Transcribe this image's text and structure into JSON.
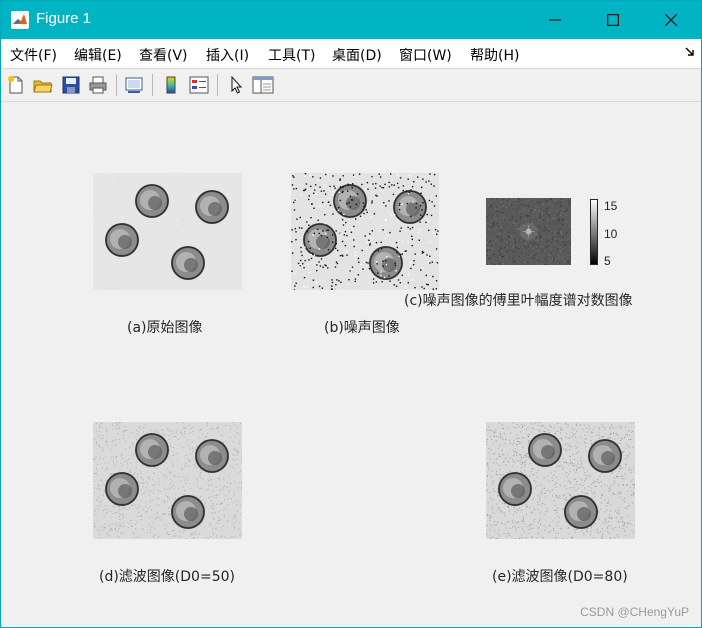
{
  "window": {
    "title": "Figure 1",
    "controls": [
      "minimize",
      "maximize",
      "close"
    ]
  },
  "menu": {
    "items": [
      "文件(F)",
      "编辑(E)",
      "查看(V)",
      "插入(I)",
      "工具(T)",
      "桌面(D)",
      "窗口(W)",
      "帮助(H)"
    ]
  },
  "toolbar": {
    "buttons": [
      {
        "icon": "new-figure-icon"
      },
      {
        "icon": "open-file-icon"
      },
      {
        "icon": "save-icon"
      },
      {
        "icon": "print-icon"
      },
      {
        "icon": "link-plot-icon"
      },
      {
        "icon": "insert-colorbar-icon"
      },
      {
        "icon": "insert-legend-icon"
      },
      {
        "icon": "pointer-icon"
      },
      {
        "icon": "property-editor-icon"
      }
    ]
  },
  "figure": {
    "captions": {
      "a": "(a)原始图像",
      "b": "(b)噪声图像",
      "c": "(c)噪声图像的傅里叶幅度谱对数图像",
      "d": "(d)滤波图像(D0=50)",
      "e": "(e)滤波图像(D0=80)"
    },
    "colorbar": {
      "ticks": [
        "15",
        "10",
        "5"
      ]
    }
  },
  "watermark": "CSDN @CHengYuP"
}
